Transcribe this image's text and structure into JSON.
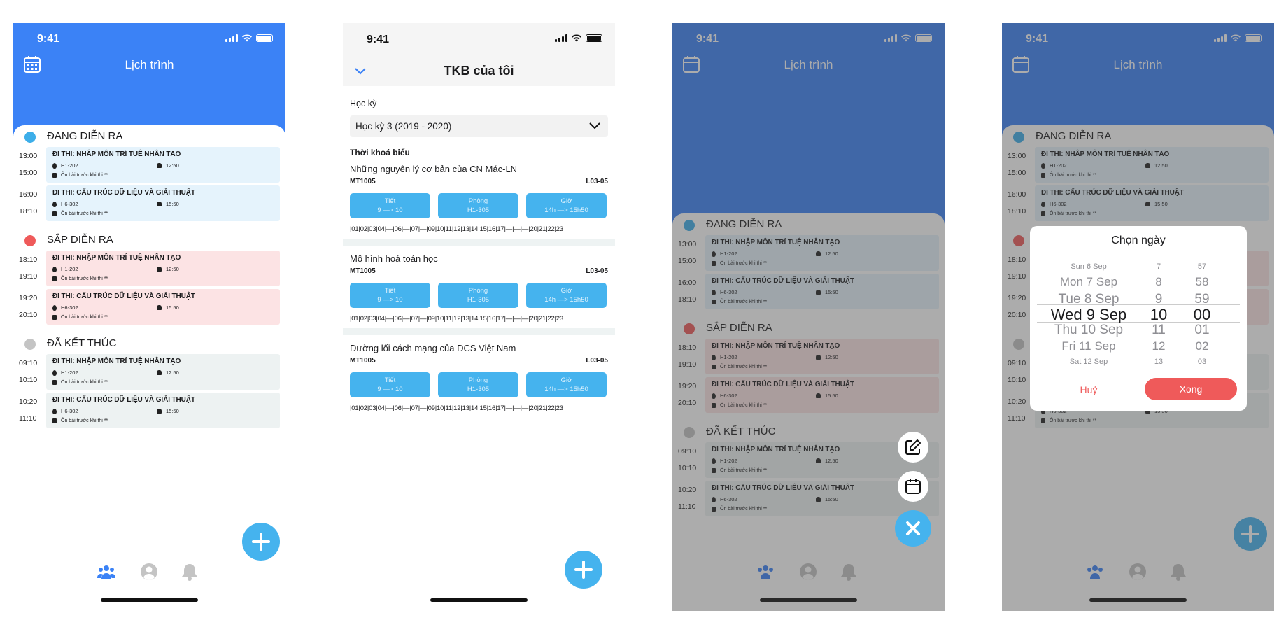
{
  "status_time": "9:41",
  "schedule": {
    "title": "Lịch trình",
    "sections": [
      {
        "label": "ĐANG DIỄN RA",
        "color": "#3daee9",
        "card_color": "#e5f3fc",
        "events": [
          {
            "start": "13:00",
            "end": "15:00",
            "name": "ĐI THI: NHẬP MÔN TRÍ TUỆ NHÂN TẠO",
            "room": "H1-202",
            "reminder": "12:50",
            "note": "Ôn bài trước khi thi **"
          },
          {
            "start": "16:00",
            "end": "18:10",
            "name": "ĐI THI: CẤU TRÚC DỮ LIỆU VÀ GIẢI THUẬT",
            "room": "H6-302",
            "reminder": "15:50",
            "note": "Ôn bài trước khi thi **"
          }
        ]
      },
      {
        "label": "SẮP DIỄN RA",
        "color": "#ef5a5a",
        "card_color": "#fce3e4",
        "events": [
          {
            "start": "18:10",
            "end": "19:10",
            "name": "ĐI THI: NHẬP MÔN TRÍ TUỆ NHÂN TẠO",
            "room": "H1-202",
            "reminder": "12:50",
            "note": "Ôn bài trước khi thi **"
          },
          {
            "start": "19:20",
            "end": "20:10",
            "name": "ĐI THI: CẤU TRÚC DỮ LIỆU VÀ GIẢI THUẬT",
            "room": "H6-302",
            "reminder": "15:50",
            "note": "Ôn bài trước khi thi **"
          }
        ]
      },
      {
        "label": "ĐÃ KẾT THÚC",
        "color": "#c4c4c4",
        "card_color": "#edf2f2",
        "events": [
          {
            "start": "09:10",
            "end": "10:10",
            "name": "ĐI THI: NHẬP MÔN TRÍ TUỆ NHÂN TẠO",
            "room": "H1-202",
            "reminder": "12:50",
            "note": "Ôn bài trước khi thi **"
          },
          {
            "start": "10:20",
            "end": "11:10",
            "name": "ĐI THI: CẤU TRÚC DỮ LIỆU VÀ GIẢI THUẬT",
            "room": "H6-302",
            "reminder": "15:50",
            "note": "Ôn bài trước khi thi **"
          }
        ]
      }
    ]
  },
  "timetable": {
    "title": "TKB của tôi",
    "semester_label": "Học kỳ",
    "semester_value": "Học kỳ 3 (2019 - 2020)",
    "section_label": "Thời khoá biểu",
    "courses": [
      {
        "name": "Những nguyên lý cơ bản của CN Mác-LN",
        "code": "MT1005",
        "group": "L03-05",
        "pills": [
          {
            "k": "Tiết",
            "v": "9 —> 10"
          },
          {
            "k": "Phòng",
            "v": "H1-305"
          },
          {
            "k": "Giờ",
            "v": "14h —> 15h50"
          }
        ],
        "weeks": "|01|02|03|04|—|06|—|07|—|09|10|11|12|13|14|15|16|17|—|—|—|20|21|22|23"
      },
      {
        "name": "Mô hình hoá toán học",
        "code": "MT1005",
        "group": "L03-05",
        "pills": [
          {
            "k": "Tiết",
            "v": "9 —> 10"
          },
          {
            "k": "Phòng",
            "v": "H1-305"
          },
          {
            "k": "Giờ",
            "v": "14h —> 15h50"
          }
        ],
        "weeks": "|01|02|03|04|—|06|—|07|—|09|10|11|12|13|14|15|16|17|—|—|—|20|21|22|23"
      },
      {
        "name": "Đường lối cách mạng của DCS Việt Nam",
        "code": "MT1005",
        "group": "L03-05",
        "pills": [
          {
            "k": "Tiết",
            "v": "9 —> 10"
          },
          {
            "k": "Phòng",
            "v": "H1-305"
          },
          {
            "k": "Giờ",
            "v": "14h —> 15h50"
          }
        ],
        "weeks": "|01|02|03|04|—|06|—|07|—|09|10|11|12|13|14|15|16|17|—|—|—|20|21|22|23"
      }
    ]
  },
  "date_picker": {
    "title": "Chọn ngày",
    "rows": [
      {
        "day": "Sun 6 Sep",
        "hour": "7",
        "min": "57"
      },
      {
        "day": "Mon 7 Sep",
        "hour": "8",
        "min": "58"
      },
      {
        "day": "Tue 8 Sep",
        "hour": "9",
        "min": "59"
      },
      {
        "day": "Wed 9 Sep",
        "hour": "10",
        "min": "00"
      },
      {
        "day": "Thu 10 Sep",
        "hour": "11",
        "min": "01"
      },
      {
        "day": "Fri 11 Sep",
        "hour": "12",
        "min": "02"
      },
      {
        "day": "Sat 12 Sep",
        "hour": "13",
        "min": "03"
      }
    ],
    "selected_index": 3,
    "cancel_label": "Huỷ",
    "ok_label": "Xong"
  },
  "colors": {
    "brand": "#3b82f6",
    "fab": "#45b3ee",
    "accent_red": "#ef5a5a"
  },
  "icons": {
    "tabs": [
      "group-icon",
      "profile-icon",
      "bell-icon"
    ],
    "header": "calendar-icon",
    "fab": "plus-icon",
    "speed_dial": [
      "edit-icon",
      "calendar-icon",
      "close-icon"
    ]
  }
}
